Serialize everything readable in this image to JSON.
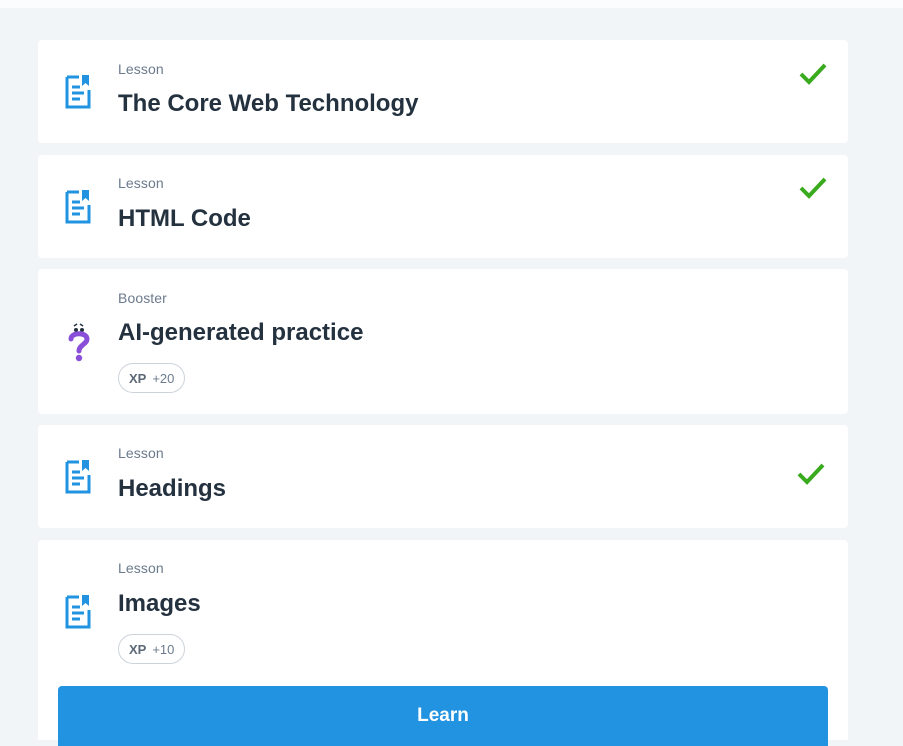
{
  "colors": {
    "page_bg": "#f2f5f8",
    "card_bg": "#ffffff",
    "lesson_icon": "#2193e0",
    "check": "#3aaa1e",
    "booster_icon": "#8a4fd8",
    "button_bg": "#2193e0"
  },
  "items": [
    {
      "type": "Lesson",
      "title": "The Core Web Technology",
      "icon": "lesson-doc-icon",
      "completed": true
    },
    {
      "type": "Lesson",
      "title": "HTML Code",
      "icon": "lesson-doc-icon",
      "completed": true
    },
    {
      "type": "Booster",
      "title": "AI-generated practice",
      "icon": "question-mark-icon",
      "completed": false,
      "xp_label": "XP",
      "xp_value": "+20"
    },
    {
      "type": "Lesson",
      "title": "Headings",
      "icon": "lesson-doc-icon",
      "completed": true
    },
    {
      "type": "Lesson",
      "title": "Images",
      "icon": "lesson-doc-icon",
      "completed": false,
      "xp_label": "XP",
      "xp_value": "+10"
    }
  ],
  "learn_button": {
    "label": "Learn"
  }
}
